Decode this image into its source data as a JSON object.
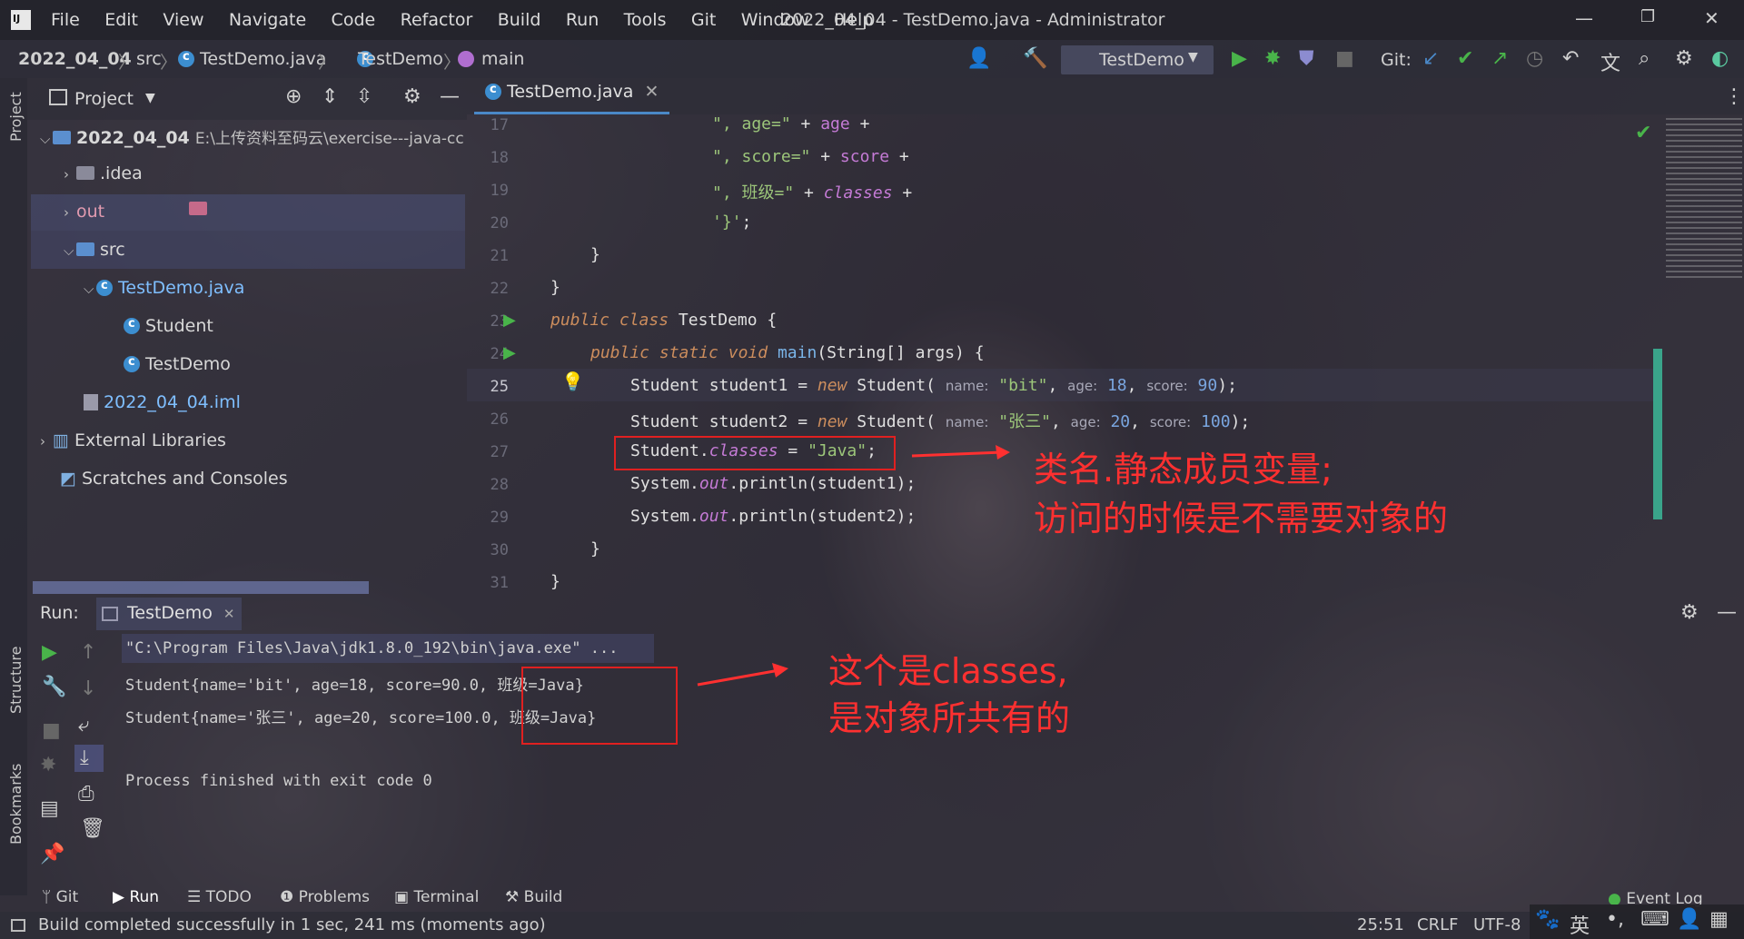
{
  "window": {
    "menu": [
      "File",
      "Edit",
      "View",
      "Navigate",
      "Code",
      "Refactor",
      "Build",
      "Run",
      "Tools",
      "Git",
      "Window",
      "Help"
    ],
    "title": "2022_04_04 - TestDemo.java - Administrator"
  },
  "breadcrumb": [
    "2022_04_04",
    "src",
    "TestDemo.java",
    "TestDemo",
    "main"
  ],
  "toolbar": {
    "run_config": "TestDemo",
    "git_label": "Git:"
  },
  "project": {
    "header": "Project",
    "root": "2022_04_04",
    "root_path": "E:\\上传资料至码云\\exercise---java-cc",
    "items": [
      ".idea",
      "out",
      "src",
      "TestDemo.java",
      "Student",
      "TestDemo",
      "2022_04_04.iml",
      "External Libraries",
      "Scratches and Consoles"
    ]
  },
  "side_labels": {
    "project": "Project",
    "structure": "Structure",
    "bookmarks": "Bookmarks"
  },
  "editor": {
    "tab": "TestDemo.java",
    "line_numbers": [
      "17",
      "18",
      "19",
      "20",
      "21",
      "22",
      "23",
      "24",
      "25",
      "26",
      "27",
      "28",
      "29",
      "30",
      "31"
    ],
    "lines": [
      {
        "a": "\", age=\"",
        "b": " + ",
        "c": "age",
        "d": " +"
      },
      {
        "a": "\", score=\"",
        "b": " + ",
        "c": "score",
        "d": " +"
      },
      {
        "a": "\", 班级=\"",
        "b": " + ",
        "c": "classes",
        "d": " +"
      },
      {
        "a": "'}'",
        "b": ";"
      },
      {
        "a": "}"
      },
      {
        "a": "}"
      },
      {
        "k1": "public",
        "k2": "class",
        "t": " TestDemo {"
      },
      {
        "k1": "public",
        "k2": "static",
        "k3": "void",
        "m": "main",
        "t": "(String[] args) {"
      },
      {
        "t1": "Student student1 = ",
        "k": "new",
        "t2": " Student(",
        "h1": "name:",
        "s": "\"bit\"",
        "h2": "age:",
        "n1": "18",
        "h3": "score:",
        "n2": "90",
        "end": ");"
      },
      {
        "t1": "Student student2 = ",
        "k": "new",
        "t2": " Student(",
        "h1": "name:",
        "s": "\"张三\"",
        "h2": "age:",
        "n1": "20",
        "h3": "score:",
        "n2": "100",
        "end": ");"
      },
      {
        "t1": "Student.",
        "f": "classes",
        "t2": " = ",
        "s": "\"Java\"",
        "end": ";"
      },
      {
        "t1": "System.",
        "f": "out",
        "t2": ".println(student1);"
      },
      {
        "t1": "System.",
        "f": "out",
        "t2": ".println(student2);"
      },
      {
        "a": "}"
      },
      {
        "a": "}"
      }
    ]
  },
  "annotations": {
    "a1_line1": "类名.静态成员变量;",
    "a1_line2": "访问的时候是不需要对象的",
    "a2_line1": "这个是classes,",
    "a2_line2": "是对象所共有的"
  },
  "run": {
    "label": "Run:",
    "tab": "TestDemo",
    "output": [
      "\"C:\\Program Files\\Java\\jdk1.8.0_192\\bin\\java.exe\" ...",
      "Student{name='bit', age=18, score=90.0, 班级=Java}",
      "Student{name='张三', age=20, score=100.0, 班级=Java}",
      "",
      "Process finished with exit code 0"
    ]
  },
  "bottom_tabs": [
    "Git",
    "Run",
    "TODO",
    "Problems",
    "Terminal",
    "Build"
  ],
  "event_log": "Event Log",
  "status": {
    "message": "Build completed successfully in 1 sec, 241 ms (moments ago)",
    "position": "25:51",
    "line_sep": "CRLF",
    "encoding": "UTF-8",
    "ime": "英"
  },
  "colors": {
    "accent": "#4a88c7",
    "annotation": "#ff3030",
    "run_green": "#49b44a"
  }
}
